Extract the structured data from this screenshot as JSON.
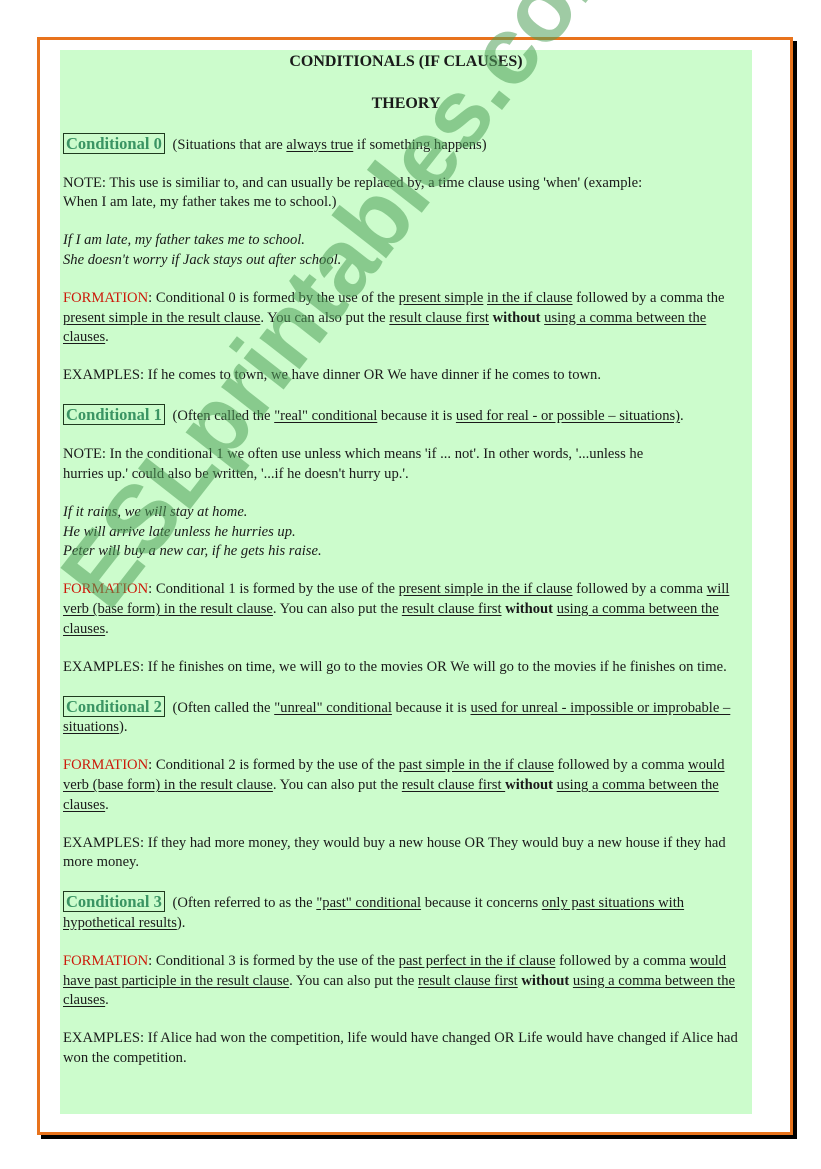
{
  "document": {
    "title": "CONDITIONALS (IF CLAUSES)",
    "subtitle": "THEORY",
    "watermark": "ESLprintables.com",
    "colors": {
      "frame_border": "#e8731c",
      "frame_shadow": "#000000",
      "content_background": "#ccfccc",
      "heading_text": "#3a9463",
      "formation_label": "#cc1a0a"
    }
  },
  "sections": [
    {
      "heading": "Conditional 0",
      "intro": [
        {
          "t": " (Situations that are "
        },
        {
          "t": "always true",
          "u": true
        },
        {
          "t": " if something happens)"
        }
      ],
      "note_lines": [
        "NOTE:  This use is similiar to, and can usually be replaced by, a time clause using 'when' (example:",
        "When I am late, my father takes me to school.)"
      ],
      "examples_italic": [
        "If I am late, my father takes me to school.",
        "She doesn't worry if Jack stays out after school."
      ],
      "formation": [
        {
          "t": "FORMATION",
          "red": true
        },
        {
          "t": ": Conditional 0 is formed by the use of the "
        },
        {
          "t": "present simple",
          "u": true
        },
        {
          "t": " "
        },
        {
          "t": "in the if clause",
          "u": true
        },
        {
          "t": " followed by a comma the "
        },
        {
          "t": "present simple in the result clause",
          "u": true
        },
        {
          "t": ".  You can also put the "
        },
        {
          "t": "result clause first",
          "u": true
        },
        {
          "t": " "
        },
        {
          "t": "without",
          "b": true
        },
        {
          "t": " "
        },
        {
          "t": "using a comma between the clauses",
          "u": true
        },
        {
          "t": "."
        }
      ],
      "examples": "EXAMPLES: If he comes to town, we have dinner    OR    We have dinner if he comes to town."
    },
    {
      "heading": "Conditional 1",
      "intro": [
        {
          "t": " (Often called the "
        },
        {
          "t": "\"real\" conditional",
          "u": true
        },
        {
          "t": " because it is "
        },
        {
          "t": "used for real - or possible – situations)",
          "u": true
        },
        {
          "t": "."
        }
      ],
      "note_lines": [
        "NOTE: In the conditional 1 we often use unless which means 'if ... not'. In other words, '...unless he",
        "hurries up.' could also be written, '...if he doesn't hurry up.'."
      ],
      "examples_italic": [
        "If it rains, we will stay at home.",
        "He will arrive late unless he hurries up.",
        "Peter will buy a new car, if he gets his raise."
      ],
      "formation": [
        {
          "t": "FORMATION",
          "red": true
        },
        {
          "t": ": Conditional 1 is formed by the use of the "
        },
        {
          "t": "present simple in the if clause",
          "u": true
        },
        {
          "t": " followed by a comma "
        },
        {
          "t": "will verb (base form) in the result clause",
          "u": true
        },
        {
          "t": ".  You can also put the "
        },
        {
          "t": "result clause first",
          "u": true
        },
        {
          "t": " "
        },
        {
          "t": "without",
          "b": true
        },
        {
          "t": " "
        },
        {
          "t": "using a comma between the clauses",
          "u": true
        },
        {
          "t": "."
        }
      ],
      "examples": "EXAMPLES: If he finishes on time, we will go to the movies    OR    We will go to the movies if he finishes on time."
    },
    {
      "heading": "Conditional 2",
      "intro": [
        {
          "t": " (Often called the "
        },
        {
          "t": "\"unreal\" conditional",
          "u": true
        },
        {
          "t": " because it is "
        },
        {
          "t": "used for unreal - impossible or improbable – situations",
          "u": true
        },
        {
          "t": ")."
        }
      ],
      "note_lines": [],
      "examples_italic": [],
      "formation": [
        {
          "t": "FORMATION",
          "red": true
        },
        {
          "t": ": Conditional 2 is formed by the use of the "
        },
        {
          "t": "past simple in the if clause",
          "u": true
        },
        {
          "t": " followed by a comma "
        },
        {
          "t": "would verb (base form) in the result clause",
          "u": true
        },
        {
          "t": ".  You can also put the "
        },
        {
          "t": "result clause first ",
          "u": true
        },
        {
          "t": "without",
          "b": true
        },
        {
          "t": " "
        },
        {
          "t": "using a comma between the clauses",
          "u": true
        },
        {
          "t": "."
        }
      ],
      "examples": "EXAMPLES: If they had more money, they would buy a new house   OR   They would buy a new house if they had more money."
    },
    {
      "heading": "Conditional 3",
      "intro": [
        {
          "t": "  (Often referred to as the "
        },
        {
          "t": "\"past\" conditional",
          "u": true
        },
        {
          "t": " because it concerns "
        },
        {
          "t": "only past situations with hypothetical results",
          "u": true
        },
        {
          "t": ")."
        }
      ],
      "note_lines": [],
      "examples_italic": [],
      "formation": [
        {
          "t": "FORMATION",
          "red": true
        },
        {
          "t": ": Conditional 3 is formed by the use of the "
        },
        {
          "t": "past perfect in the if clause",
          "u": true
        },
        {
          "t": " followed by a comma "
        },
        {
          "t": "would have past participle in the result clause",
          "u": true
        },
        {
          "t": ".  You can also put the "
        },
        {
          "t": "result clause first",
          "u": true
        },
        {
          "t": " "
        },
        {
          "t": "without",
          "b": true
        },
        {
          "t": " "
        },
        {
          "t": "using a comma between the clauses",
          "u": true
        },
        {
          "t": "."
        }
      ],
      "examples": "EXAMPLES: If Alice had won the competition, life would have changed OR Life would have changed if Alice had won the competition."
    }
  ]
}
